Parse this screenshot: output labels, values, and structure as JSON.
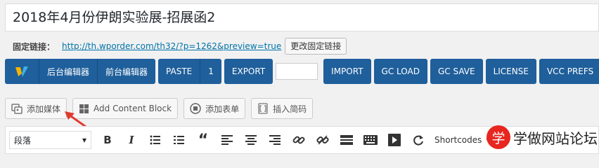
{
  "post_title": "2018年4月份伊朗实验展-招展函2",
  "permalink": {
    "label": "固定链接：",
    "url": "http://th.wporder.com/th32/?p=1262&preview=true",
    "change_button": "更改固定链接"
  },
  "vc_bar": {
    "backend_editor": "后台编辑器",
    "frontend_editor": "前台编辑器",
    "paste": "PASTE",
    "paste_count": "1",
    "export": "EXPORT",
    "import": "IMPORT",
    "gc_load": "GC LOAD",
    "gc_save": "GC SAVE",
    "license": "LICENSE",
    "vcc_prefs": "VCC PREFS",
    "brand_color": "#1f5f9b"
  },
  "media_buttons": {
    "add_media": "添加媒体",
    "add_content_block": "Add Content Block",
    "add_form": "添加表单",
    "insert_shortcode": "插入简码"
  },
  "editor_toolbar": {
    "format_value": "段落",
    "shortcodes_label": "Shortcodes"
  },
  "watermark": {
    "logo_char": "学",
    "text": "学做网站论坛",
    "color": "#e8251f"
  }
}
